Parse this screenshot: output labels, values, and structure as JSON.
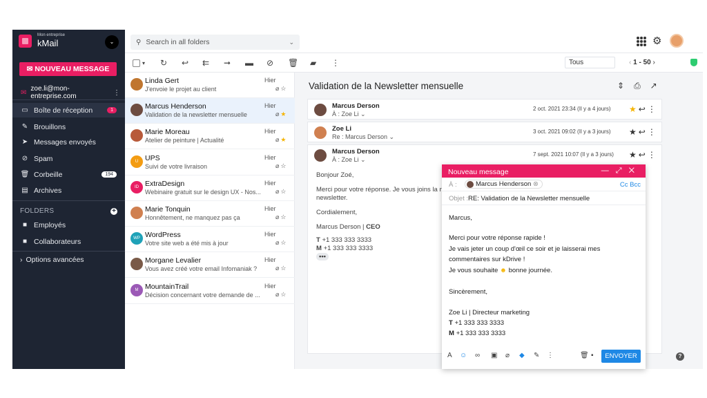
{
  "brand": {
    "company": "Mon entreprise",
    "app": "kMail"
  },
  "sidebar": {
    "new_message": "NOUVEAU MESSAGE",
    "account": "zoe.li@mon-entreprise.com",
    "items": [
      {
        "label": "Boîte de réception",
        "badge": "1"
      },
      {
        "label": "Brouillons"
      },
      {
        "label": "Messages envoyés"
      },
      {
        "label": "Spam"
      },
      {
        "label": "Corbeille",
        "badge": "194"
      },
      {
        "label": "Archives"
      }
    ],
    "folders_title": "FOLDERS",
    "folders": [
      {
        "label": "Employés"
      },
      {
        "label": "Collaborateurs"
      }
    ],
    "advanced": "Options avancées"
  },
  "search": {
    "placeholder": "Search in all folders"
  },
  "toolbar": {
    "filter": "Tous",
    "pager": "1 - 50"
  },
  "messages": [
    {
      "from": "Linda Gert",
      "subject": "J'envoie le projet au client",
      "date": "Hier",
      "color": "#c0762f"
    },
    {
      "from": "Marcus Henderson",
      "subject": "Validation de la newsletter mensuelle",
      "date": "Hier",
      "color": "#6d4c41",
      "active": true,
      "starred": true
    },
    {
      "from": "Marie Moreau",
      "subject": "Atelier de peinture | Actualité",
      "date": "Hier",
      "color": "#b85a3a",
      "starred": true
    },
    {
      "from": "UPS",
      "subject": "Suivi de votre livraison",
      "date": "Hier",
      "color": "#f39c12",
      "initials": "U"
    },
    {
      "from": "ExtraDesign",
      "subject": "Webinaire gratuit sur le design UX - Nos...",
      "date": "Hier",
      "color": "#e91e63",
      "initials": "ID"
    },
    {
      "from": "Marie Tonquin",
      "subject": "Honnêtement, ne manquez pas ça",
      "date": "Hier",
      "color": "#d08050"
    },
    {
      "from": "WordPress",
      "subject": "Votre site web a été mis à jour",
      "date": "Hier",
      "color": "#1fa2b8",
      "initials": "WP"
    },
    {
      "from": "Morgane Levalier",
      "subject": "Vous avez créé votre email Infomaniak ?",
      "date": "Hier",
      "color": "#7a5a48"
    },
    {
      "from": "MountainTrail",
      "subject": "Décision concernant votre demande de ...",
      "date": "Hier",
      "color": "#9b59b6",
      "initials": "M"
    }
  ],
  "reader": {
    "title": "Validation de la Newsletter mensuelle",
    "thread": [
      {
        "name": "Marcus Derson",
        "to": "À : Zoe Li",
        "date": "2 oct. 2021 23:34 (Il y a 4 jours)",
        "starred": true
      },
      {
        "name": "Zoe Li",
        "to": "Re : Marcus Derson",
        "date": "3 oct. 2021 09:02 (Il y a 3 jours)"
      },
      {
        "name": "Marcus Derson",
        "to": "À : Zoe Li",
        "date": "7 sept. 2021 10:07 (Il y a 3 jours)"
      }
    ],
    "body": {
      "greeting": "Bonjour Zoé,",
      "line1": "Merci pour votre réponse. Je vous joins la n",
      "line2": "newsletter.",
      "closing": "Cordialement,",
      "sig_name": "Marcus Derson",
      "sig_role": "CEO",
      "phone_t": "+1 333 333 3333",
      "phone_m": "+1 333 333 3333"
    }
  },
  "compose": {
    "title": "Nouveau message",
    "to_label": "À :",
    "to": "Marcus Henderson",
    "ccbcc": "Cc Bcc",
    "subject_label": "Objet :",
    "subject": "RE: Validation de la Newsletter mensuelle",
    "body": {
      "greeting": "Marcus,",
      "l1": "Merci pour votre réponse rapide !",
      "l2": "Je vais jeter un coup d'œil ce soir et je laisserai mes",
      "l3": "commentaires sur kDrive !",
      "l4_pre": "Je vous souhaite ",
      "l4_post": " bonne journée.",
      "closing": "Sincèrement,",
      "sig_name": "Zoe Li",
      "sig_role": "Directeur marketing",
      "phone_t": "+1 333 333 3333",
      "phone_m": "+1 333 333 3333"
    },
    "send": "ENVOYER"
  },
  "colors": {
    "accent": "#e91e63",
    "sidebar": "#1e2533",
    "blue": "#1e88e5"
  }
}
